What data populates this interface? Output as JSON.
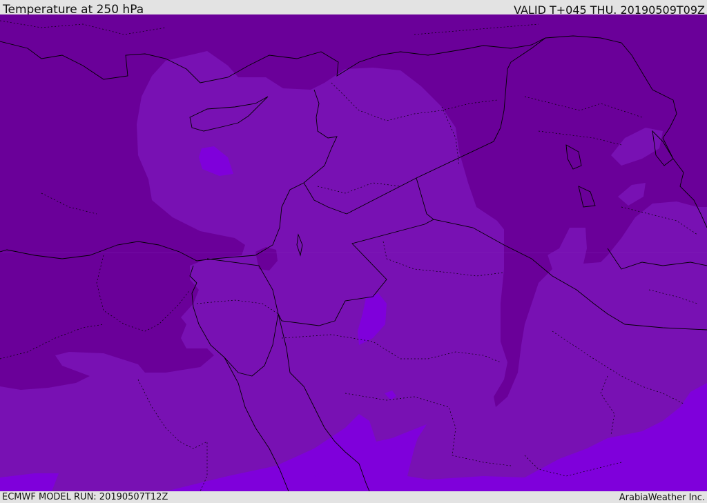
{
  "header": {
    "title": "Temperature at 250 hPa",
    "valid_time": "VALID T+045 THU. 20190509T09Z"
  },
  "footer": {
    "model_run": "ECMWF MODEL RUN: 20190507T12Z",
    "credit": "ArabiaWeather Inc."
  },
  "colors": {
    "cold_band": "#6a0099",
    "mid_band": "#7811b3",
    "warm_band": "#7f00db",
    "border_line": "#000000",
    "background": "#e3e3e3"
  }
}
